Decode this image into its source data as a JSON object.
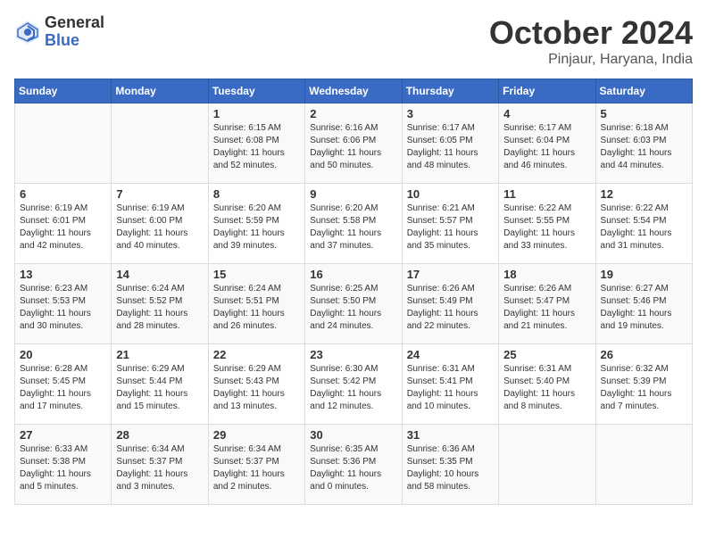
{
  "header": {
    "logo_general": "General",
    "logo_blue": "Blue",
    "month_title": "October 2024",
    "location": "Pinjaur, Haryana, India"
  },
  "days_of_week": [
    "Sunday",
    "Monday",
    "Tuesday",
    "Wednesday",
    "Thursday",
    "Friday",
    "Saturday"
  ],
  "weeks": [
    [
      {
        "day": "",
        "info": ""
      },
      {
        "day": "",
        "info": ""
      },
      {
        "day": "1",
        "info": "Sunrise: 6:15 AM\nSunset: 6:08 PM\nDaylight: 11 hours\nand 52 minutes."
      },
      {
        "day": "2",
        "info": "Sunrise: 6:16 AM\nSunset: 6:06 PM\nDaylight: 11 hours\nand 50 minutes."
      },
      {
        "day": "3",
        "info": "Sunrise: 6:17 AM\nSunset: 6:05 PM\nDaylight: 11 hours\nand 48 minutes."
      },
      {
        "day": "4",
        "info": "Sunrise: 6:17 AM\nSunset: 6:04 PM\nDaylight: 11 hours\nand 46 minutes."
      },
      {
        "day": "5",
        "info": "Sunrise: 6:18 AM\nSunset: 6:03 PM\nDaylight: 11 hours\nand 44 minutes."
      }
    ],
    [
      {
        "day": "6",
        "info": "Sunrise: 6:19 AM\nSunset: 6:01 PM\nDaylight: 11 hours\nand 42 minutes."
      },
      {
        "day": "7",
        "info": "Sunrise: 6:19 AM\nSunset: 6:00 PM\nDaylight: 11 hours\nand 40 minutes."
      },
      {
        "day": "8",
        "info": "Sunrise: 6:20 AM\nSunset: 5:59 PM\nDaylight: 11 hours\nand 39 minutes."
      },
      {
        "day": "9",
        "info": "Sunrise: 6:20 AM\nSunset: 5:58 PM\nDaylight: 11 hours\nand 37 minutes."
      },
      {
        "day": "10",
        "info": "Sunrise: 6:21 AM\nSunset: 5:57 PM\nDaylight: 11 hours\nand 35 minutes."
      },
      {
        "day": "11",
        "info": "Sunrise: 6:22 AM\nSunset: 5:55 PM\nDaylight: 11 hours\nand 33 minutes."
      },
      {
        "day": "12",
        "info": "Sunrise: 6:22 AM\nSunset: 5:54 PM\nDaylight: 11 hours\nand 31 minutes."
      }
    ],
    [
      {
        "day": "13",
        "info": "Sunrise: 6:23 AM\nSunset: 5:53 PM\nDaylight: 11 hours\nand 30 minutes."
      },
      {
        "day": "14",
        "info": "Sunrise: 6:24 AM\nSunset: 5:52 PM\nDaylight: 11 hours\nand 28 minutes."
      },
      {
        "day": "15",
        "info": "Sunrise: 6:24 AM\nSunset: 5:51 PM\nDaylight: 11 hours\nand 26 minutes."
      },
      {
        "day": "16",
        "info": "Sunrise: 6:25 AM\nSunset: 5:50 PM\nDaylight: 11 hours\nand 24 minutes."
      },
      {
        "day": "17",
        "info": "Sunrise: 6:26 AM\nSunset: 5:49 PM\nDaylight: 11 hours\nand 22 minutes."
      },
      {
        "day": "18",
        "info": "Sunrise: 6:26 AM\nSunset: 5:47 PM\nDaylight: 11 hours\nand 21 minutes."
      },
      {
        "day": "19",
        "info": "Sunrise: 6:27 AM\nSunset: 5:46 PM\nDaylight: 11 hours\nand 19 minutes."
      }
    ],
    [
      {
        "day": "20",
        "info": "Sunrise: 6:28 AM\nSunset: 5:45 PM\nDaylight: 11 hours\nand 17 minutes."
      },
      {
        "day": "21",
        "info": "Sunrise: 6:29 AM\nSunset: 5:44 PM\nDaylight: 11 hours\nand 15 minutes."
      },
      {
        "day": "22",
        "info": "Sunrise: 6:29 AM\nSunset: 5:43 PM\nDaylight: 11 hours\nand 13 minutes."
      },
      {
        "day": "23",
        "info": "Sunrise: 6:30 AM\nSunset: 5:42 PM\nDaylight: 11 hours\nand 12 minutes."
      },
      {
        "day": "24",
        "info": "Sunrise: 6:31 AM\nSunset: 5:41 PM\nDaylight: 11 hours\nand 10 minutes."
      },
      {
        "day": "25",
        "info": "Sunrise: 6:31 AM\nSunset: 5:40 PM\nDaylight: 11 hours\nand 8 minutes."
      },
      {
        "day": "26",
        "info": "Sunrise: 6:32 AM\nSunset: 5:39 PM\nDaylight: 11 hours\nand 7 minutes."
      }
    ],
    [
      {
        "day": "27",
        "info": "Sunrise: 6:33 AM\nSunset: 5:38 PM\nDaylight: 11 hours\nand 5 minutes."
      },
      {
        "day": "28",
        "info": "Sunrise: 6:34 AM\nSunset: 5:37 PM\nDaylight: 11 hours\nand 3 minutes."
      },
      {
        "day": "29",
        "info": "Sunrise: 6:34 AM\nSunset: 5:37 PM\nDaylight: 11 hours\nand 2 minutes."
      },
      {
        "day": "30",
        "info": "Sunrise: 6:35 AM\nSunset: 5:36 PM\nDaylight: 11 hours\nand 0 minutes."
      },
      {
        "day": "31",
        "info": "Sunrise: 6:36 AM\nSunset: 5:35 PM\nDaylight: 10 hours\nand 58 minutes."
      },
      {
        "day": "",
        "info": ""
      },
      {
        "day": "",
        "info": ""
      }
    ]
  ]
}
